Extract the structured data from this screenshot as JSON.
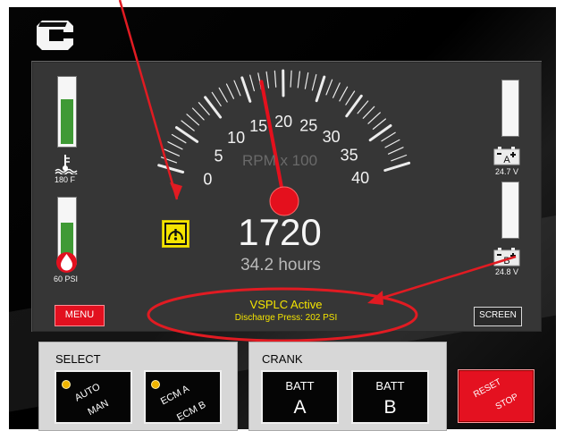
{
  "gauge": {
    "tick_labels": [
      "0",
      "5",
      "10",
      "15",
      "20",
      "25",
      "30",
      "35",
      "40"
    ],
    "unit_label": "RPM x 100",
    "rpm_value": "1720",
    "hours_value": "34.2 hours",
    "needle_reading": 17.2
  },
  "left_indicators": {
    "temperature_label": "180 F",
    "temperature_level": 0.72,
    "pressure_label": "60 PSI",
    "pressure_level": 0.66
  },
  "right_indicators": {
    "battery_a_label": "A",
    "battery_a_voltage": "24.7 V",
    "battery_a_level": 0.0,
    "battery_b_label": "B",
    "battery_b_voltage": "24.8 V",
    "battery_b_level": 0.0
  },
  "panel_buttons": {
    "menu_label": "MENU",
    "screen_label": "SCREEN"
  },
  "status": {
    "title": "VSPLC Active",
    "subtitle": "Discharge Press: 202 PSI"
  },
  "select_panel": {
    "title": "SELECT",
    "mode_button": {
      "line1": "AUTO",
      "line2": "MAN"
    },
    "ecm_button": {
      "line1": "ECM A",
      "line2": "ECM B"
    }
  },
  "crank_panel": {
    "title": "CRANK",
    "buttons": [
      {
        "line1": "BATT",
        "line2": "A"
      },
      {
        "line1": "BATT",
        "line2": "B"
      }
    ]
  },
  "reset_button": {
    "line1": "RESET",
    "line2": "STOP"
  },
  "colors": {
    "panel": "#363636",
    "gauge_fill": "#3f9a35",
    "warning": "#f4e400",
    "accent_red": "#e2101f"
  },
  "icons": {
    "brand": "cummins-logo-icon",
    "temperature": "temperature-icon",
    "pressure": "oil-pressure-icon",
    "warning": "warning-icon",
    "battery": "battery-icon"
  }
}
